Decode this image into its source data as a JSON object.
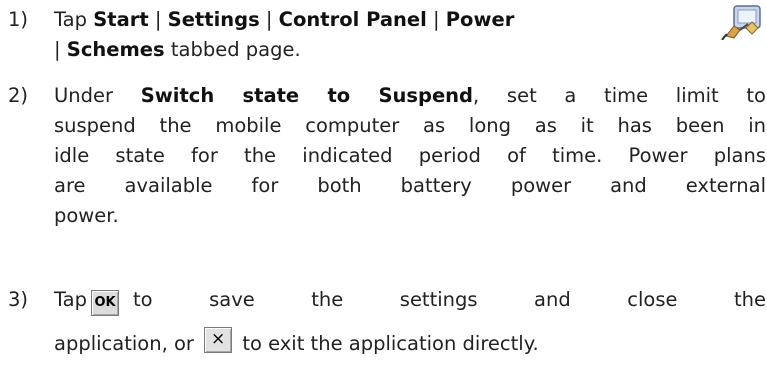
{
  "steps": [
    {
      "num": "1)",
      "pre": "Tap ",
      "start": "Start",
      "sep1": " | ",
      "settings": "Settings",
      "sep2": " | ",
      "control_panel": "Control Panel",
      "sep3": " | ",
      "power": "Power",
      "line2_sep": "| ",
      "schemes": "Schemes",
      "line2_tail": " tabbed page."
    },
    {
      "num": "2)",
      "pre": "Under ",
      "bold": "Switch state to Suspend",
      "rest_l1": ", set a time limit to",
      "l2": "suspend the mobile computer as long as it has been in",
      "l3": "idle state for the indicated period of time. Power plans",
      "l4": "are available for both battery power and external",
      "l5": "power."
    },
    {
      "num": "3)",
      "pre": "Tap",
      "ok_label": "OK",
      "l1_rest": "to save the settings and close the",
      "l2_pre": "application, or",
      "x_label": "×",
      "l2_rest": "to exit the application directly."
    }
  ],
  "icons": {
    "power_icon": "power-plug-icon",
    "ok_button": "ok-button-icon",
    "close_button": "close-x-button-icon"
  }
}
